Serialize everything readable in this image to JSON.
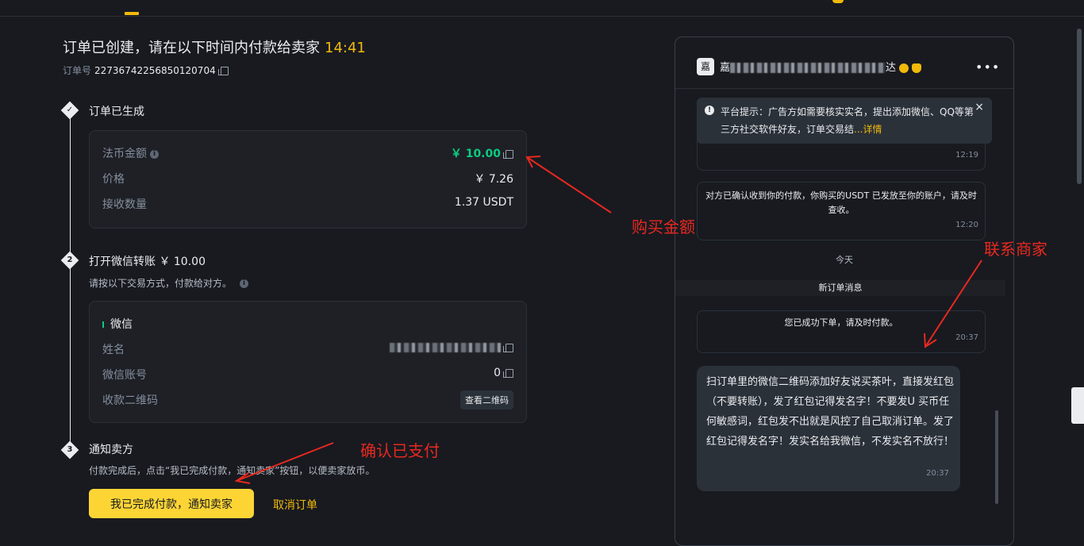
{
  "order": {
    "title": "订单已创建，请在以下时间内付款给卖家",
    "timer": "14:41",
    "number_label": "订单号",
    "number": "22736742256850120704"
  },
  "steps": [
    {
      "marker": "✓",
      "title": "订单已生成",
      "rows": [
        {
          "label": "法币金额",
          "value": "￥ 10.00"
        },
        {
          "label": "价格",
          "value": "￥ 7.26"
        },
        {
          "label": "接收数量",
          "value": "1.37 USDT"
        }
      ]
    },
    {
      "marker": "2",
      "title": "打开微信转账 ￥ 10.00",
      "desc": "请按以下交易方式，付款给对方。",
      "method": "微信",
      "rows": [
        {
          "label": "姓名",
          "value": ""
        },
        {
          "label": "微信账号",
          "value": "0"
        },
        {
          "label": "收款二维码",
          "value": "查看二维码"
        }
      ]
    },
    {
      "marker": "3",
      "title": "通知卖方",
      "desc": "付款完成后，点击“我已完成付款，通知卖家”按钮，以便卖家放币。"
    }
  ],
  "actions": {
    "confirm_label": "我已完成付款，通知卖家",
    "cancel_label": "取消订单"
  },
  "chat": {
    "avatar": "嘉",
    "name_prefix": "嘉",
    "name_suffix": "达",
    "notice": "平台提示：广告方如需要核实实名，提出添加微信、QQ等第三方社交软件好友，订单交易结",
    "notice_more": "...详情",
    "notice_close": "×",
    "messages": [
      {
        "text": "",
        "time": "12:19"
      },
      {
        "text": "对方已确认收到你的付款，你购买的USDT 已发放至你的账户，请及时查收。",
        "time": "12:20"
      },
      {
        "text": "您已成功下单，请及时付款。",
        "time": "20:37"
      }
    ],
    "date_separator": "今天",
    "new_order": "新订单消息",
    "seller_message": {
      "text": "扫订单里的微信二维码添加好友说买茶叶，直接发红包（不要转账），发了红包记得发名字！不要发U 买币任何敏感词，红包发不出就是风控了自己取消订单。发了红包记得发名字！发实名给我微信，不发实名不放行！",
      "time": "20:37"
    }
  },
  "annotations": {
    "amount": "购买金额",
    "contact": "联系商家",
    "confirm": "确认已支付"
  },
  "colors": {
    "accent": "#f0b90b",
    "button": "#fcd535",
    "green": "#0ecb81",
    "annotation": "#e8281f"
  }
}
